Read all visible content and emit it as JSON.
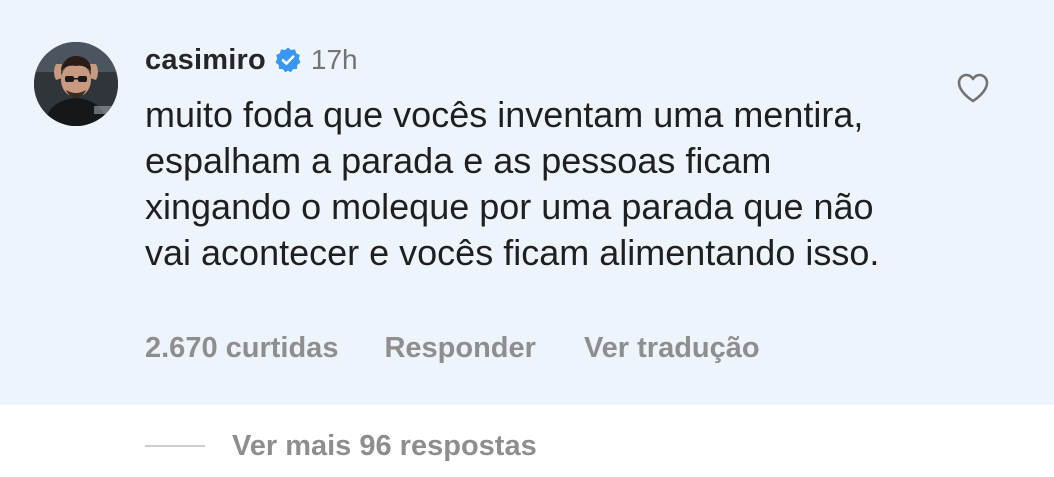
{
  "comment": {
    "username": "casimiro",
    "verified": true,
    "timestamp": "17h",
    "text": "muito foda que vocês inventam uma mentira, espalham a parada e as pessoas ficam xingando o moleque por uma parada que não vai acontecer e vocês ficam alimentando isso.",
    "likes_label": "2.670 curtidas",
    "reply_label": "Responder",
    "translate_label": "Ver tradução",
    "like_icon": "heart-outline-icon",
    "verified_icon": "verified-badge-icon"
  },
  "replies": {
    "more_label": "Ver mais 96 respostas"
  },
  "colors": {
    "card_background": "#eef4fb",
    "verified_blue": "#3897f0",
    "secondary_text": "#8e8e8e"
  }
}
